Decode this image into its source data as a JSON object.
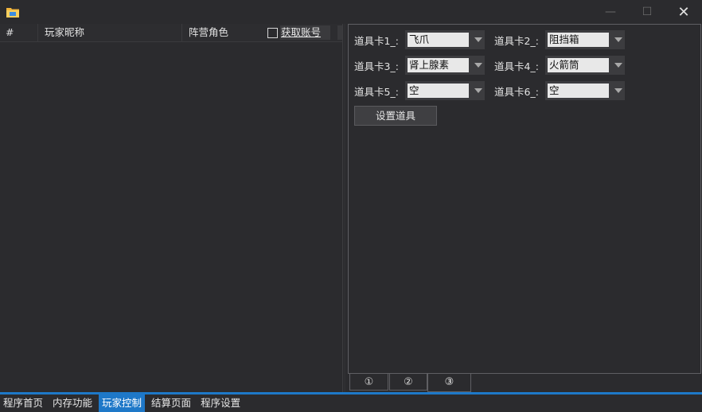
{
  "window": {
    "icon": "folder-app-icon",
    "minimize_glyph": "—",
    "maximize_glyph": "☐",
    "close_glyph": "✕"
  },
  "player_list": {
    "columns": [
      "#",
      "玩家昵称",
      "阵营角色"
    ],
    "get_account_label": "获取账号",
    "get_account_checked": false,
    "rows": []
  },
  "items_panel": {
    "slots": [
      {
        "label": "道具卡1_:",
        "value": "飞爪"
      },
      {
        "label": "道具卡2_:",
        "value": "阻挡箱"
      },
      {
        "label": "道具卡3_:",
        "value": "肾上腺素"
      },
      {
        "label": "道具卡4_:",
        "value": "火箭筒"
      },
      {
        "label": "道具卡5_:",
        "value": "空"
      },
      {
        "label": "道具卡6_:",
        "value": "空"
      }
    ],
    "set_button_label": "设置道具"
  },
  "tabs": [
    "①",
    "②",
    "③"
  ],
  "active_tab": 2,
  "nav": {
    "items": [
      "程序首页",
      "内存功能",
      "玩家控制",
      "结算页面",
      "程序设置"
    ],
    "active": 2
  },
  "colors": {
    "accent": "#1e78c8",
    "background": "#2b2b2e"
  }
}
